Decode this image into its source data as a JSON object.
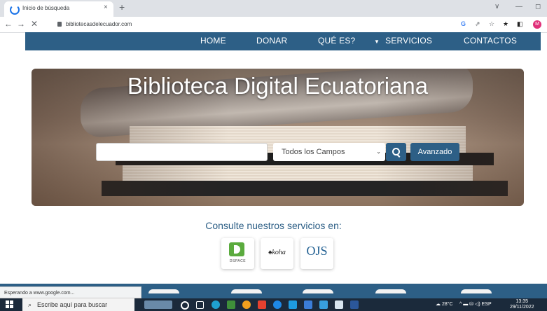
{
  "browser": {
    "tab_title": "Inicio de búsqueda",
    "tab_close": "×",
    "new_tab": "+",
    "url": "bibliotecasdelecuador.com",
    "nav_back": "←",
    "nav_forward": "→",
    "nav_stop": "✕",
    "window_buttons": [
      "∨",
      "—",
      "◻"
    ],
    "toolbar_icons": [
      "G",
      "⇗",
      "☆",
      "★",
      "◧"
    ],
    "profile_initial": "M"
  },
  "site_nav": {
    "items": [
      "HOME",
      "DONAR",
      "QUÉ ES?",
      "SERVICIOS",
      "CONTACTOS"
    ],
    "caret": "▼"
  },
  "hero": {
    "title": "Biblioteca Digital Ecuatoriana",
    "search_placeholder": "",
    "field_select_value": "Todos los Campos",
    "advanced_label": "Avanzado"
  },
  "services": {
    "caption": "Consulte nuestros servicios en:",
    "items": [
      {
        "name": "DSPACE"
      },
      {
        "name": "koha"
      },
      {
        "name": "OJS"
      }
    ]
  },
  "status_bar": {
    "text": "Esperando a www.google.com..."
  },
  "taskbar": {
    "search_placeholder": "Escribe aquí para buscar",
    "weather": "28°C",
    "lang": "ESP",
    "time": "13:35",
    "date": "29/11/2022"
  },
  "colors": {
    "nav_blue": "#2d5f86",
    "dspace_green": "#5bab3e",
    "ojs_blue": "#1f5e91",
    "taskbar": "#1b2a3b"
  }
}
